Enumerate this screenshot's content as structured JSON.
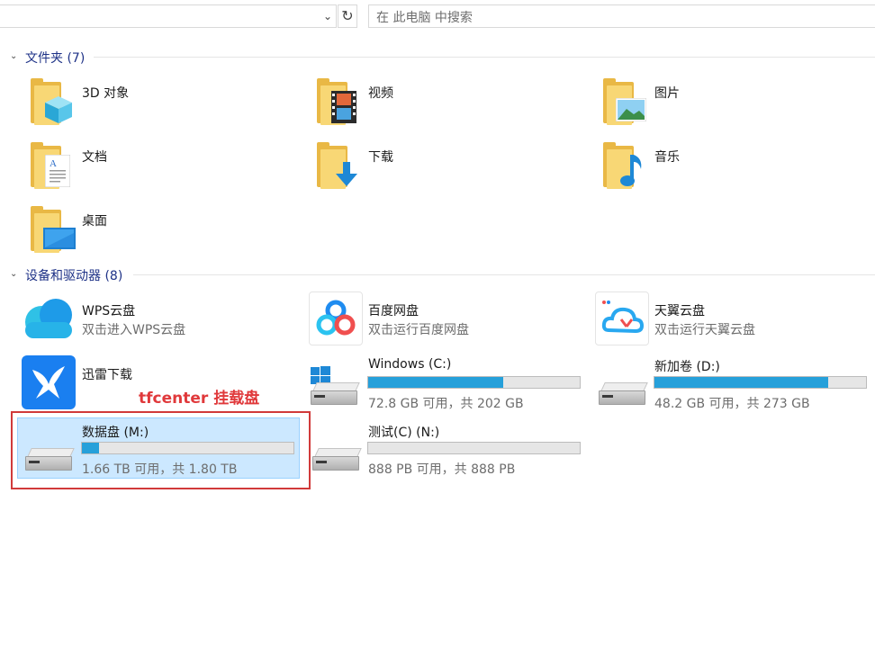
{
  "search": {
    "placeholder": "在 此电脑 中搜索"
  },
  "groups": {
    "folders": {
      "title": "文件夹 (7)"
    },
    "devices": {
      "title": "设备和驱动器 (8)"
    }
  },
  "folders": [
    {
      "label": "3D 对象",
      "icon": "3d-objects-folder-icon"
    },
    {
      "label": "视频",
      "icon": "videos-folder-icon"
    },
    {
      "label": "图片",
      "icon": "pictures-folder-icon"
    },
    {
      "label": "文档",
      "icon": "documents-folder-icon"
    },
    {
      "label": "下载",
      "icon": "downloads-folder-icon"
    },
    {
      "label": "音乐",
      "icon": "music-folder-icon"
    },
    {
      "label": "桌面",
      "icon": "desktop-folder-icon"
    }
  ],
  "apps": [
    {
      "label": "WPS云盘",
      "sub": "双击进入WPS云盘",
      "icon": "wps-cloud-icon"
    },
    {
      "label": "百度网盘",
      "sub": "双击运行百度网盘",
      "icon": "baidu-netdisk-icon"
    },
    {
      "label": "天翼云盘",
      "sub": "双击运行天翼云盘",
      "icon": "tianyi-cloud-icon"
    },
    {
      "label": "迅雷下载",
      "icon": "xunlei-icon"
    }
  ],
  "drives": [
    {
      "label": "Windows  (C:)",
      "info": "72.8 GB 可用，共 202 GB",
      "used_fraction": 0.64
    },
    {
      "label": "新加卷 (D:)",
      "info": "48.2 GB 可用，共 273 GB",
      "used_fraction": 0.82
    },
    {
      "label": "数据盘 (M:)",
      "info": "1.66 TB 可用，共 1.80 TB",
      "used_fraction": 0.08
    },
    {
      "label": "测试(C) (N:)",
      "info": "888 PB 可用，共 888 PB",
      "used_fraction": 0.0
    }
  ],
  "annotation": {
    "text": "tfcenter 挂载盘"
  },
  "colors": {
    "bar_fill": "#26a0da",
    "selection": "#cce8ff",
    "annotation": "#d13a3a",
    "group_title": "#1e3287"
  }
}
